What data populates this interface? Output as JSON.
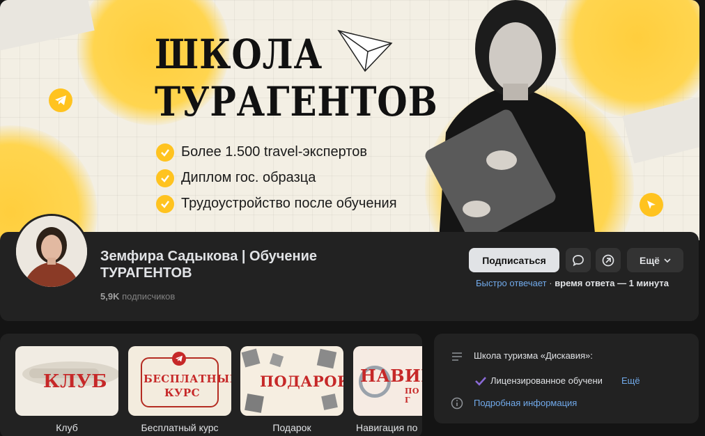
{
  "cover": {
    "title_line1": "ШКОЛА",
    "title_line2": "ТУРАГЕНТОВ",
    "bullets": [
      "Более 1.500 travel-экспертов",
      "Диплом гос. образца",
      "Трудоустройство после обучения"
    ],
    "accent_color": "#ffc31f"
  },
  "profile": {
    "name": "Земфира Садыкова | Обучение ТУРАГЕНТОВ",
    "subscribers_count": "5,9K",
    "subscribers_label": "подписчиков",
    "subscribe_label": "Подписаться",
    "more_label": "Ещё",
    "reply_fast": "Быстро отвечает",
    "reply_sep": " · ",
    "reply_time": "время ответа — 1 минута",
    "icons": [
      "message-icon",
      "share-icon",
      "chevron-down-icon"
    ]
  },
  "cards": [
    {
      "caption": "Клуб",
      "stamp": "КЛУБ"
    },
    {
      "caption": "Бесплатный курс",
      "stamp_line1": "БЕСПЛАТНЫЙ",
      "stamp_line2": "КУРС"
    },
    {
      "caption": "Подарок",
      "stamp": "ПОДАРОК"
    },
    {
      "caption": "Навигация по",
      "stamp": "НАВИГА",
      "stamp_small": "ПО Г"
    }
  ],
  "info": {
    "org": "Школа туризма «Дискавия»:",
    "license": "Лицензированное обучени",
    "license_more": "Ещё",
    "details": "Подробная информация"
  }
}
